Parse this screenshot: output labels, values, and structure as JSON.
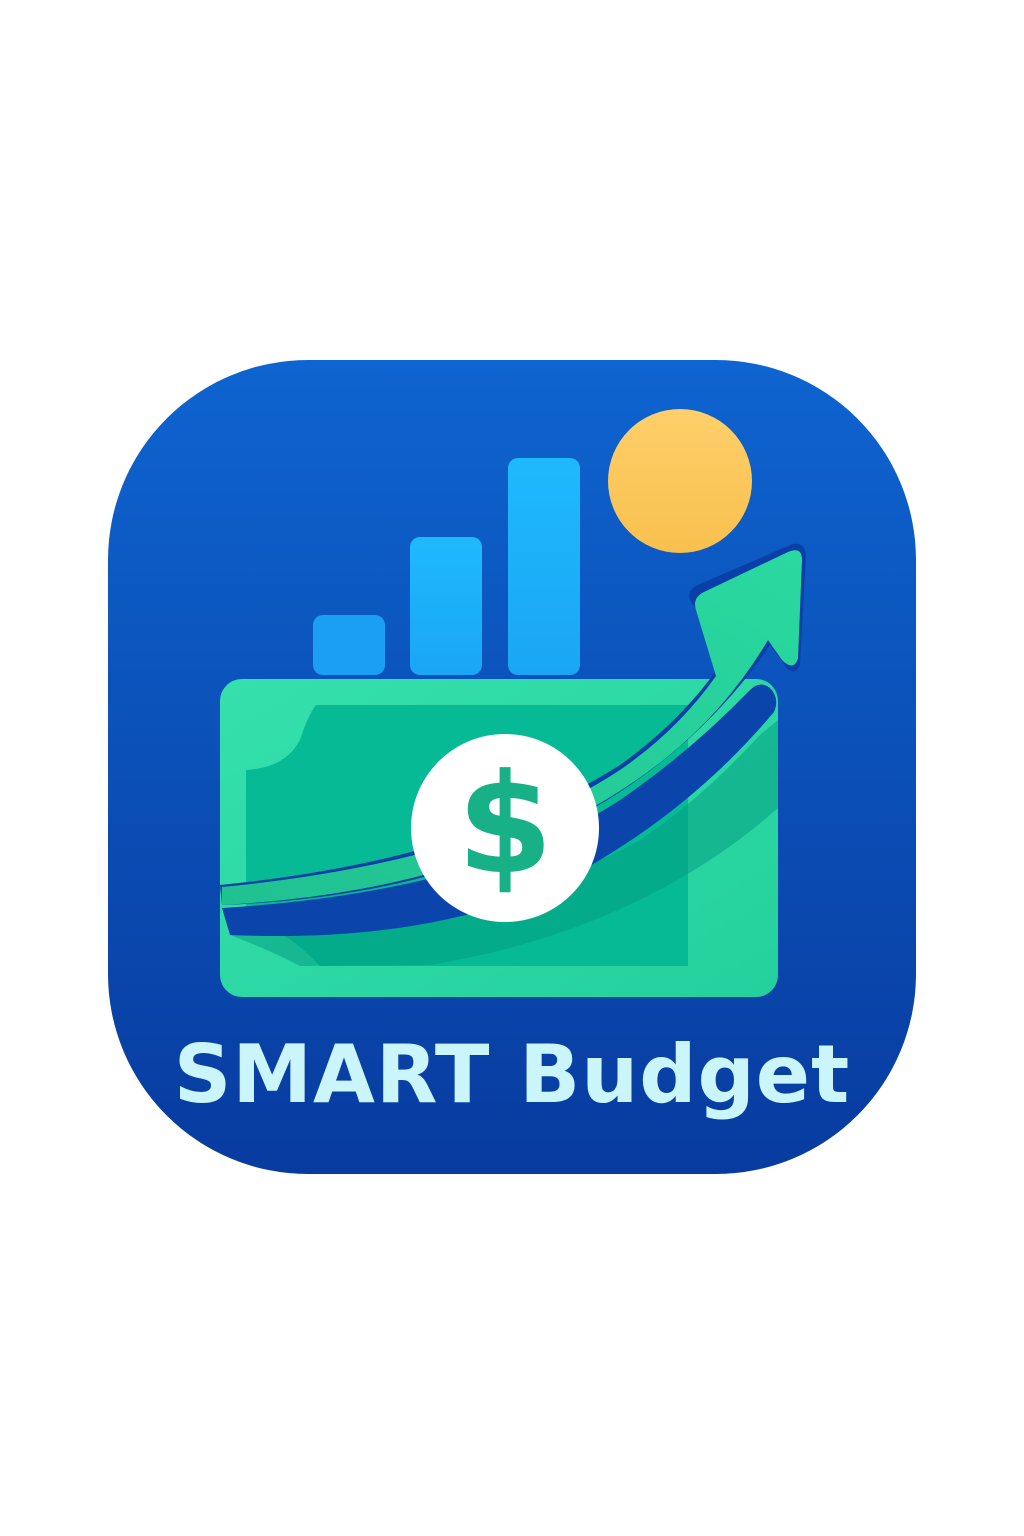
{
  "app": {
    "name": "SMART Budget"
  },
  "icon": {
    "bar_chart_icon": "bar-chart-icon",
    "coin_icon": "coin-icon",
    "banknote_icon": "banknote-icon",
    "trend_arrow_icon": "trend-arrow-up-icon",
    "dollar_icon": "dollar-sign-icon"
  },
  "colors": {
    "background": "#ffffff",
    "tile_top": "#0e63cf",
    "tile_bottom": "#083aa0",
    "bar_dark": "#1a9bf2",
    "bar_light": "#1fbcfd",
    "coin": "#ffc654",
    "banknote": "#2ed6a3",
    "banknote_inner": "#06b995",
    "arrow": "#24d39c",
    "dollar": "#18b086",
    "title_text": "#c9f5fb"
  }
}
